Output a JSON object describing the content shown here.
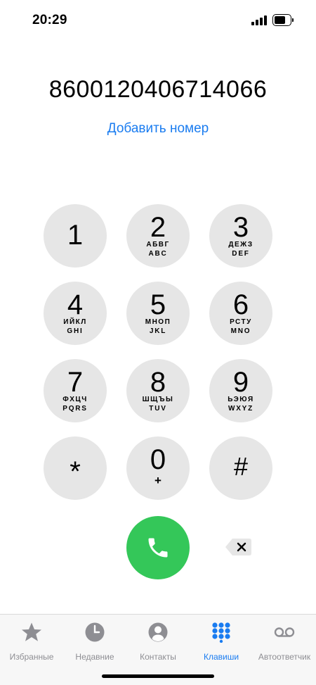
{
  "status_bar": {
    "time": "20:29"
  },
  "dialer": {
    "number": "8600120406714066",
    "add_number": "Добавить номер"
  },
  "keypad": [
    {
      "digit": "1",
      "cyrillic": "",
      "latin": ""
    },
    {
      "digit": "2",
      "cyrillic": "АБВГ",
      "latin": "ABC"
    },
    {
      "digit": "3",
      "cyrillic": "ДЕЖЗ",
      "latin": "DEF"
    },
    {
      "digit": "4",
      "cyrillic": "ИЙКЛ",
      "latin": "GHI"
    },
    {
      "digit": "5",
      "cyrillic": "МНОП",
      "latin": "JKL"
    },
    {
      "digit": "6",
      "cyrillic": "РСТУ",
      "latin": "MNO"
    },
    {
      "digit": "7",
      "cyrillic": "ФХЦЧ",
      "latin": "PQRS"
    },
    {
      "digit": "8",
      "cyrillic": "ШЩЪЫ",
      "latin": "TUV"
    },
    {
      "digit": "9",
      "cyrillic": "ЬЭЮЯ",
      "latin": "WXYZ"
    },
    {
      "digit": "*",
      "cyrillic": "",
      "latin": ""
    },
    {
      "digit": "0",
      "cyrillic": "",
      "latin": "+"
    },
    {
      "digit": "#",
      "cyrillic": "",
      "latin": ""
    }
  ],
  "call_button": {
    "icon": "phone-icon",
    "color": "#34c759"
  },
  "delete_button": {
    "icon": "delete-backspace-icon"
  },
  "tab_bar": {
    "active_color": "#1a7cf0",
    "inactive_color": "#8e8e93",
    "tabs": [
      {
        "label": "Избранные",
        "icon": "star-icon",
        "active": false
      },
      {
        "label": "Недавние",
        "icon": "clock-icon",
        "active": false
      },
      {
        "label": "Контакты",
        "icon": "person-circle-icon",
        "active": false
      },
      {
        "label": "Клавиши",
        "icon": "keypad-icon",
        "active": true
      },
      {
        "label": "Автоответчик",
        "icon": "voicemail-icon",
        "active": false
      }
    ]
  }
}
